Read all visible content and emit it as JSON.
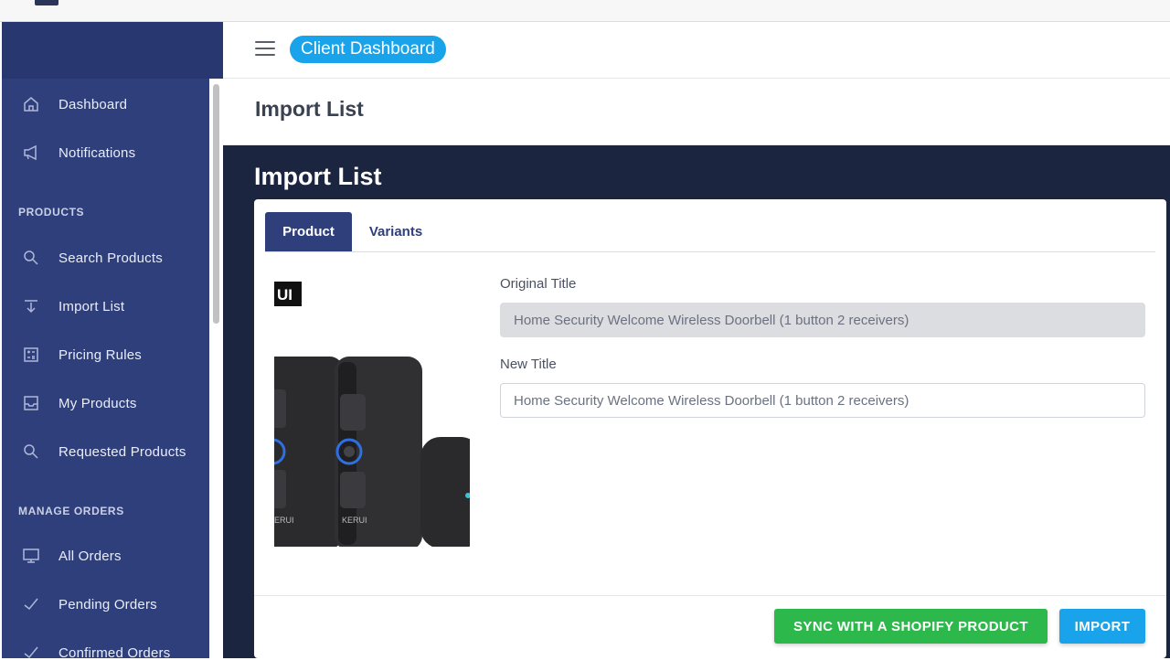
{
  "topbar": {
    "client_pill": "Client Dashboard"
  },
  "sidebar": {
    "items": [
      {
        "label": "Dashboard",
        "icon": "home-icon"
      },
      {
        "label": "Notifications",
        "icon": "megaphone-icon"
      }
    ],
    "sections": [
      {
        "title": "PRODUCTS",
        "items": [
          {
            "label": "Search Products",
            "icon": "search-icon"
          },
          {
            "label": "Import List",
            "icon": "import-icon"
          },
          {
            "label": "Pricing Rules",
            "icon": "calculator-icon"
          },
          {
            "label": "My Products",
            "icon": "inbox-icon"
          },
          {
            "label": "Requested Products",
            "icon": "search-icon"
          }
        ]
      },
      {
        "title": "MANAGE ORDERS",
        "items": [
          {
            "label": "All Orders",
            "icon": "monitor-icon"
          },
          {
            "label": "Pending Orders",
            "icon": "check-icon"
          },
          {
            "label": "Confirmed Orders",
            "icon": "check-icon"
          }
        ]
      }
    ]
  },
  "page": {
    "header_title": "Import List",
    "band_title": "Import List"
  },
  "card": {
    "tabs": [
      {
        "label": "Product",
        "active": true
      },
      {
        "label": "Variants",
        "active": false
      }
    ],
    "original_title_label": "Original Title",
    "original_title_value": "Home Security Welcome Wireless Doorbell (1 button 2 receivers)",
    "new_title_label": "New Title",
    "new_title_value": "Home Security Welcome Wireless Doorbell (1 button 2 receivers)",
    "product_image": {
      "brand_mark": "UI",
      "device_text": "KERUI"
    },
    "buttons": {
      "sync": "SYNC WITH A SHOPIFY PRODUCT",
      "import": "IMPORT"
    }
  },
  "colors": {
    "sidebar": "#2f3f7c",
    "band": "#1c2540",
    "accent_blue": "#18a3ea",
    "accent_green": "#2cb84b"
  }
}
